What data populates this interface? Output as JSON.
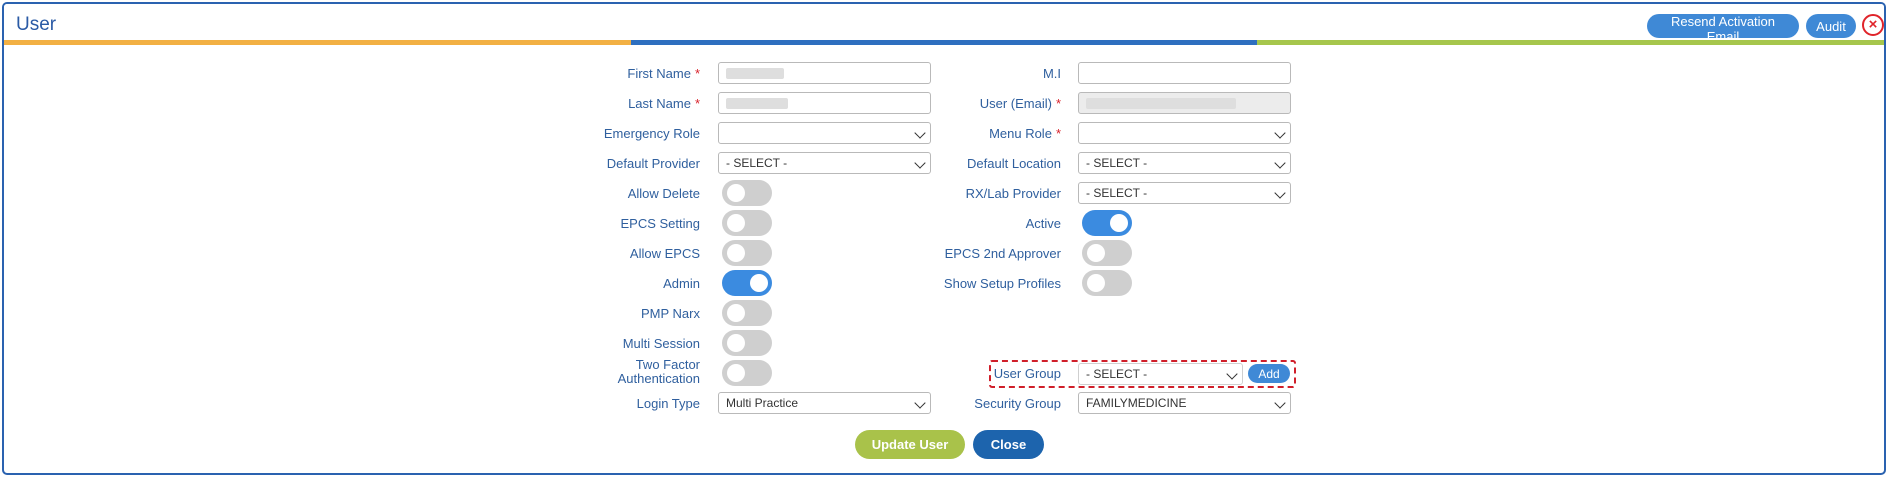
{
  "window": {
    "title": "User"
  },
  "header": {
    "resend_label": "Resend Activation Email",
    "audit_label": "Audit",
    "close_icon": "⊗"
  },
  "form": {
    "first_name": {
      "label": "First Name",
      "required": "*"
    },
    "last_name": {
      "label": "Last Name",
      "required": "*"
    },
    "mi": {
      "label": "M.I",
      "value": ""
    },
    "user_email": {
      "label": "User (Email)",
      "required": "*"
    },
    "emergency_role": {
      "label": "Emergency Role",
      "value": ""
    },
    "menu_role": {
      "label": "Menu Role",
      "required": "*",
      "value": ""
    },
    "default_provider": {
      "label": "Default Provider",
      "value": "- SELECT -"
    },
    "default_location": {
      "label": "Default Location",
      "value": "- SELECT -"
    },
    "allow_delete": {
      "label": "Allow Delete",
      "on": false
    },
    "rx_lab_provider": {
      "label": "RX/Lab Provider",
      "value": "- SELECT -"
    },
    "epcs_setting": {
      "label": "EPCS Setting",
      "on": false
    },
    "active": {
      "label": "Active",
      "on": true
    },
    "allow_epcs": {
      "label": "Allow EPCS",
      "on": false
    },
    "epcs_2nd_approver": {
      "label": "EPCS 2nd Approver",
      "on": false
    },
    "admin": {
      "label": "Admin",
      "on": true
    },
    "show_setup_profiles": {
      "label": "Show Setup Profiles",
      "on": false
    },
    "pmp_narx": {
      "label": "PMP Narx",
      "on": false
    },
    "multi_session": {
      "label": "Multi Session",
      "on": false
    },
    "two_factor": {
      "label_line1": "Two Factor",
      "label_line2": "Authentication",
      "on": false
    },
    "user_group": {
      "label": "User Group",
      "value": "- SELECT -",
      "add_label": "Add"
    },
    "login_type": {
      "label": "Login Type",
      "value": "Multi Practice"
    },
    "security_group": {
      "label": "Security Group",
      "value": "FAMILYMEDICINE"
    }
  },
  "footer": {
    "update_label": "Update User",
    "close_label": "Close"
  },
  "colors": {
    "accent_blue": "#3f89d6",
    "toggle_on": "#3b8be0",
    "update_green": "#a9c24a",
    "close_blue": "#1d64ad",
    "required_red": "#d8202a"
  }
}
